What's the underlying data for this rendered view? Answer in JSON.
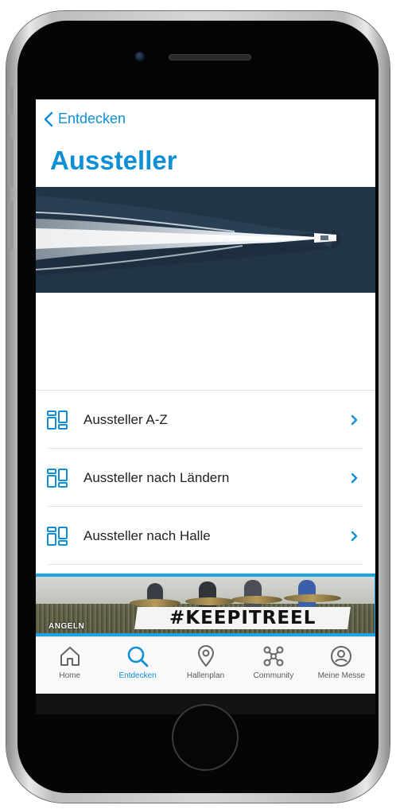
{
  "nav": {
    "back_label": "Entdecken"
  },
  "page": {
    "title": "Aussteller"
  },
  "list": {
    "items": [
      {
        "label": "Aussteller A-Z"
      },
      {
        "label": "Aussteller nach Ländern"
      },
      {
        "label": "Aussteller nach Halle"
      }
    ]
  },
  "banner": {
    "hashtag": "#KEEPITREEL",
    "category": "ANGELN"
  },
  "tabbar": {
    "tabs": [
      {
        "label": "Home",
        "icon": "home-icon"
      },
      {
        "label": "Entdecken",
        "icon": "search-icon"
      },
      {
        "label": "Hallenplan",
        "icon": "location-pin-icon"
      },
      {
        "label": "Community",
        "icon": "network-icon"
      },
      {
        "label": "Meine Messe",
        "icon": "user-icon"
      }
    ],
    "active": "Entdecken"
  },
  "colors": {
    "accent": "#0e8fd6",
    "banner_border": "#1aa4e5"
  }
}
